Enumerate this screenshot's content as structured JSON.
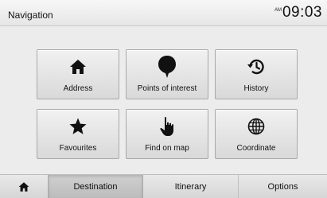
{
  "header": {
    "title": "Navigation",
    "ampm": "AM",
    "time": "09:03"
  },
  "menu": {
    "tiles": [
      {
        "label": "Address",
        "icon": "home-icon"
      },
      {
        "label": "Points of interest",
        "icon": "map-pin-icon"
      },
      {
        "label": "History",
        "icon": "history-icon"
      },
      {
        "label": "Favourites",
        "icon": "star-icon"
      },
      {
        "label": "Find on map",
        "icon": "pointing-hand-icon"
      },
      {
        "label": "Coordinate",
        "icon": "globe-icon"
      }
    ]
  },
  "tabs": {
    "home_icon": "home-icon",
    "items": [
      "Destination",
      "Itinerary",
      "Options"
    ],
    "active": "Destination"
  },
  "colors": {
    "background": "#ececec",
    "tile": "#e3e3e3",
    "active_tab": "#c6c6c6"
  }
}
